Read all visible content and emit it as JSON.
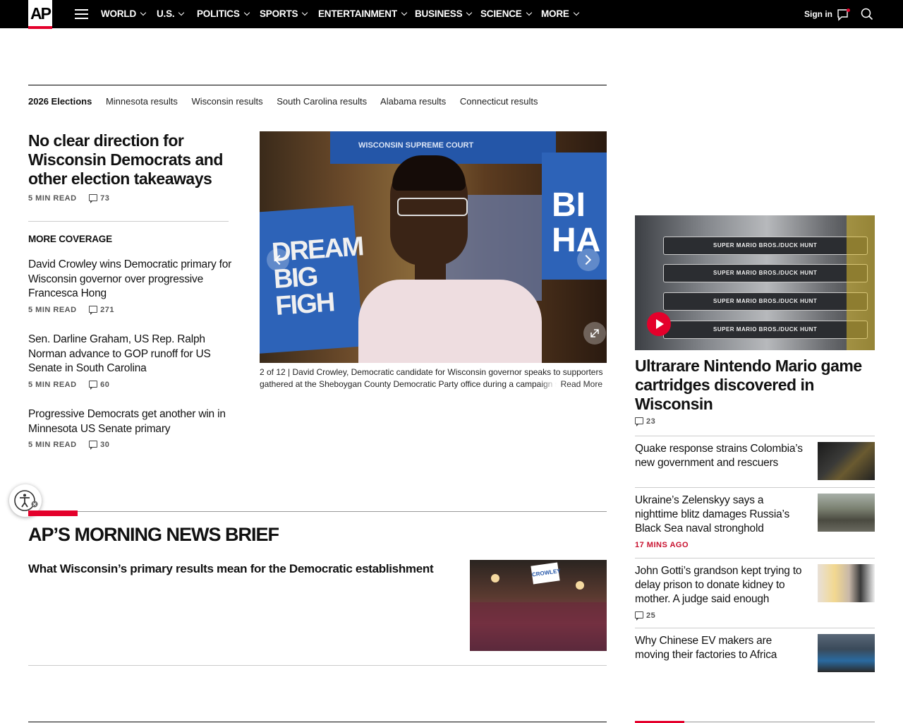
{
  "header": {
    "logo": "AP",
    "nav": [
      {
        "label": "WORLD"
      },
      {
        "label": "U.S."
      },
      {
        "label": "POLITICS"
      },
      {
        "label": "SPORTS"
      },
      {
        "label": "ENTERTAINMENT"
      },
      {
        "label": "BUSINESS"
      },
      {
        "label": "SCIENCE"
      },
      {
        "label": "MORE"
      }
    ],
    "signin": "Sign in"
  },
  "elections": {
    "lead": "2026 Elections",
    "links": [
      "Minnesota results",
      "Wisconsin results",
      "South Carolina results",
      "Alabama results",
      "Connecticut results"
    ]
  },
  "lead_story": {
    "headline": "No clear direction for Wisconsin Democrats and other election takeaways",
    "read_time": "5 MIN READ",
    "comments": "73"
  },
  "more_coverage": {
    "title": "MORE COVERAGE",
    "items": [
      {
        "title": "David Crowley wins Democratic primary for Wisconsin governor over progressive Francesca Hong",
        "read_time": "5 MIN READ",
        "comments": "271"
      },
      {
        "title": "Sen. Darline Graham, US Rep. Ralph Norman advance to GOP runoff for US Senate in South Carolina",
        "read_time": "5 MIN READ",
        "comments": "60"
      },
      {
        "title": "Progressive Democrats get another win in Minnesota US Senate primary",
        "read_time": "5 MIN READ",
        "comments": "30"
      }
    ]
  },
  "slideshow": {
    "counter": "2 of 12 |",
    "caption": "David Crowley, Democratic candidate for Wisconsin governor speaks to supporters gathered at the Sheboygan County Democratic Party office during a campaign s",
    "read_more": "Read More",
    "photo_text": {
      "left_sign": "DREAM BIG FIGH",
      "right_sign": "BI HA",
      "banner": "WISCONSIN SUPREME COURT"
    }
  },
  "morning_brief": {
    "title": "AP’S MORNING NEWS BRIEF",
    "story": "What Wisconsin’s primary results mean for the Democratic establishment",
    "image_sign": "CROWLEY"
  },
  "right_rail": {
    "feature": {
      "headline": "Ultrarare Nintendo Mario game cartridges discovered in Wisconsin",
      "comments": "23",
      "cartridge_label": "SUPER MARIO BROS./DUCK HUNT"
    },
    "items": [
      {
        "title": "Quake response strains Colombia’s new government and rescuers"
      },
      {
        "title": "Ukraine’s Zelenskyy says a nighttime blitz damages Russia’s Black Sea naval stronghold",
        "time": "17 MINS AGO"
      },
      {
        "title": "John Gotti’s grandson kept trying to delay prison to donate kidney to mother. A judge said enough",
        "comments": "25"
      },
      {
        "title": "Why Chinese EV makers are moving their factories to Africa"
      }
    ]
  },
  "colors": {
    "ap_red": "#e4002b",
    "nav_bg": "#000000"
  }
}
